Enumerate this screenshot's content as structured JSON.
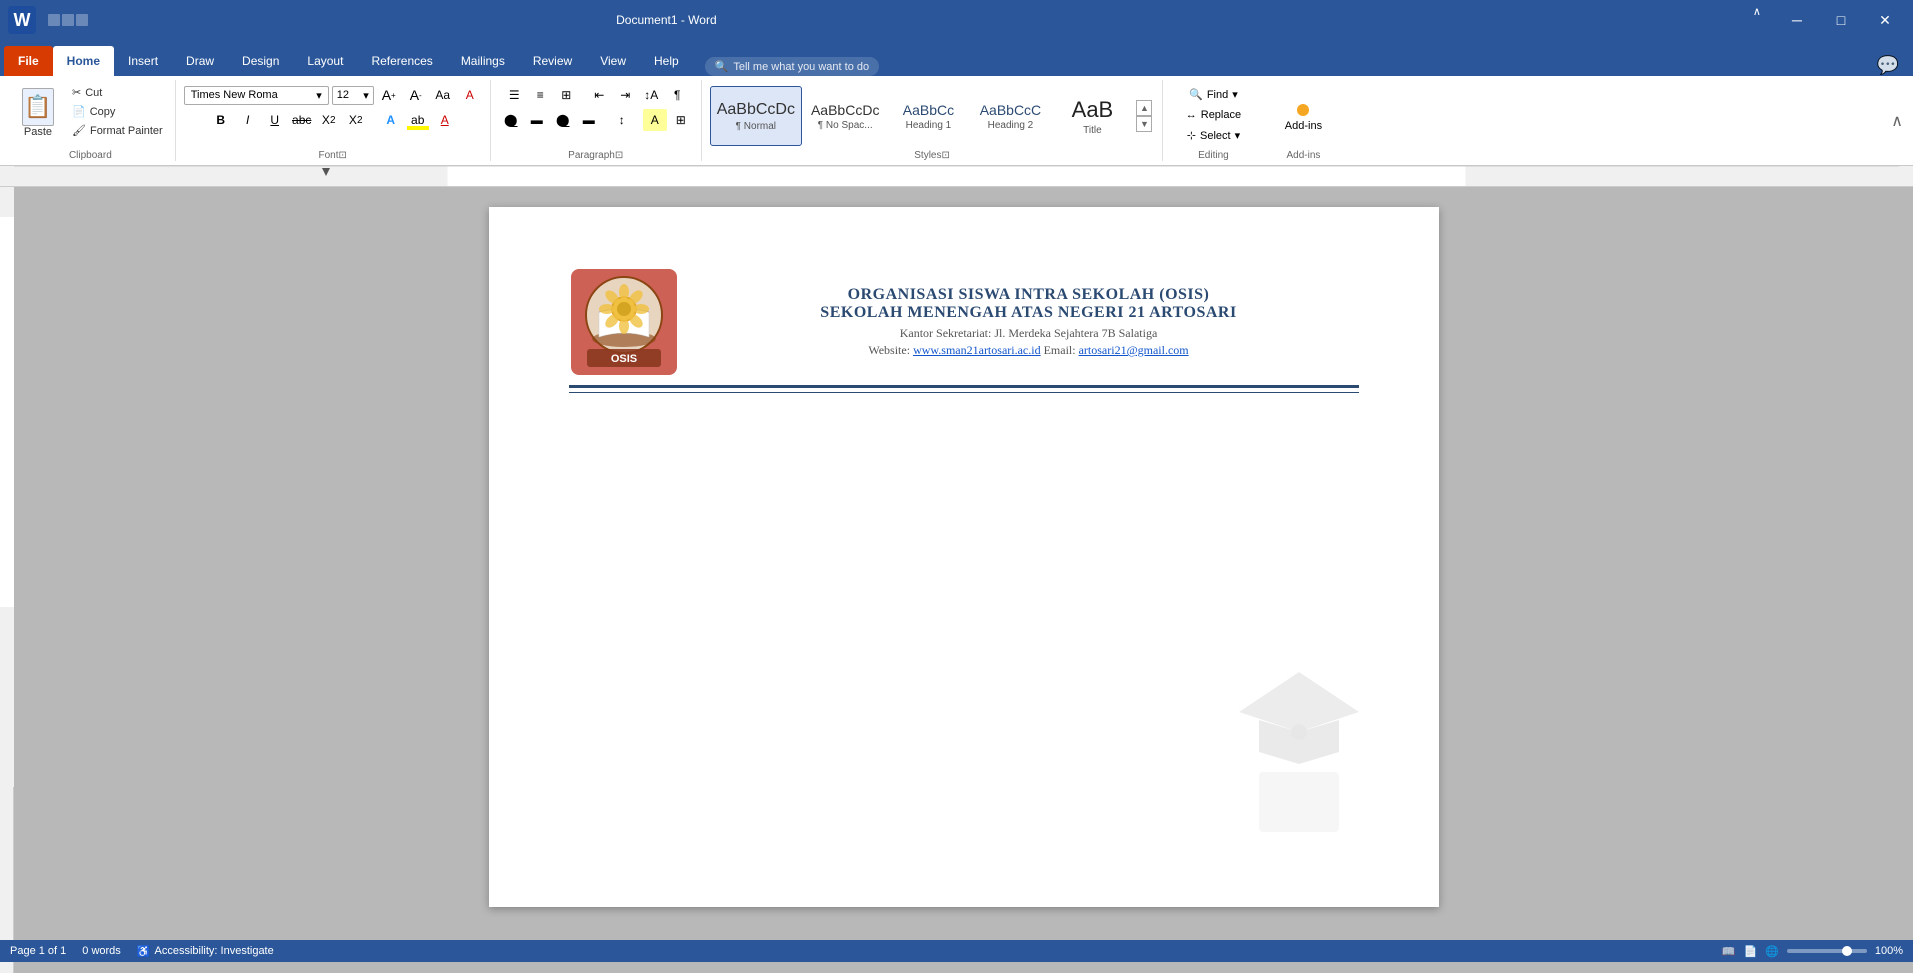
{
  "titlebar": {
    "filename": "Document1 - Word",
    "app_icon": "W"
  },
  "tabs": [
    {
      "label": "File",
      "active": false
    },
    {
      "label": "Home",
      "active": true
    },
    {
      "label": "Insert",
      "active": false
    },
    {
      "label": "Draw",
      "active": false
    },
    {
      "label": "Design",
      "active": false
    },
    {
      "label": "Layout",
      "active": false
    },
    {
      "label": "References",
      "active": false
    },
    {
      "label": "Mailings",
      "active": false
    },
    {
      "label": "Review",
      "active": false
    },
    {
      "label": "View",
      "active": false
    },
    {
      "label": "Help",
      "active": false
    }
  ],
  "clipboard": {
    "paste_label": "Paste",
    "cut_label": "Cut",
    "copy_label": "Copy",
    "format_painter_label": "Format Painter"
  },
  "font": {
    "name": "Times New Roma",
    "size": "12",
    "bold": "B",
    "italic": "I",
    "underline": "U"
  },
  "styles": {
    "normal_label": "¶ Normal",
    "nospace_label": "¶ No Spac...",
    "heading1_label": "Heading 1",
    "heading2_label": "Heading 2",
    "title_label": "Title"
  },
  "editing": {
    "find_label": "Find",
    "replace_label": "Replace",
    "select_label": "Select"
  },
  "search_bar": {
    "placeholder": "Tell me what you want to do"
  },
  "document": {
    "org_line1": "ORGANISASI SISWA INTRA SEKOLAH (OSIS)",
    "org_line2": "SEKOLAH MENENGAH ATAS NEGERI 21 ARTOSARI",
    "address": "Kantor Sekretariat: Jl. Merdeka Sejahtera 7B Salatiga",
    "website_label": "Website:",
    "website_url": "www.sman21artosari.ac.id",
    "email_label": "Email:",
    "email_address": "artosari21@gmail.com"
  },
  "status": {
    "page": "Page 1 of 1",
    "words": "0 words",
    "accessibility": "Accessibility: Investigate",
    "zoom": "100%"
  },
  "addins": {
    "label": "Add-ins"
  }
}
